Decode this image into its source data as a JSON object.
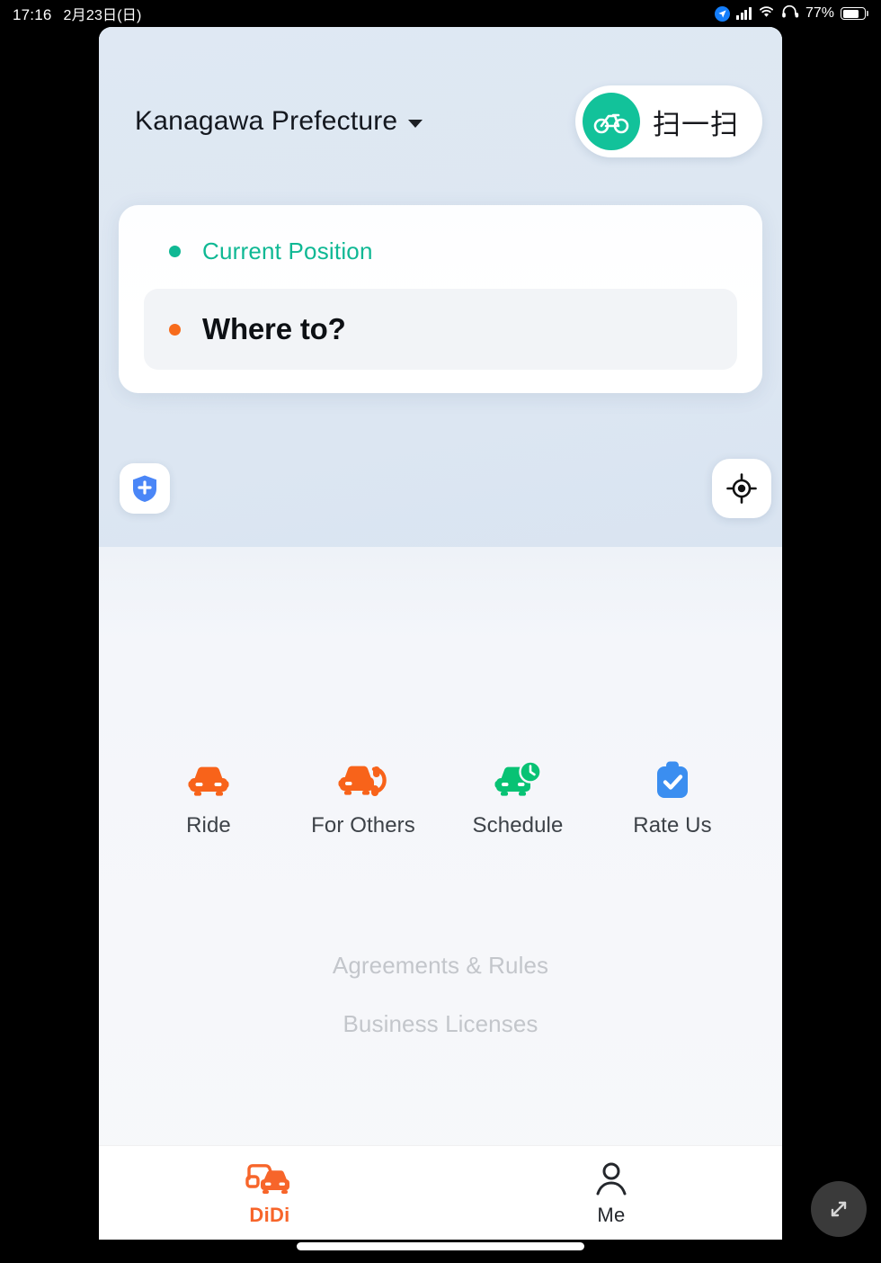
{
  "status_bar": {
    "time": "17:16",
    "date": "2月23日(日)",
    "battery_percent": "77%",
    "icons": [
      "location-arrow-icon",
      "cellular-signal-icon",
      "wifi-icon",
      "headphones-icon",
      "battery-icon"
    ]
  },
  "map": {
    "city_selector": {
      "label": "Kanagawa Prefecture",
      "icon": "chevron-down-icon"
    },
    "scan_button": {
      "label": "扫一扫",
      "icon": "bicycle-icon",
      "accent": "#12c29a"
    },
    "position_bubble": {
      "label": "Current Position",
      "chevron": "›"
    },
    "safety_button": {
      "icon": "shield-plus-icon",
      "color": "#4a86f7"
    },
    "locate_button": {
      "icon": "crosshair-locate-icon",
      "color": "#111111"
    }
  },
  "search": {
    "origin": {
      "label": "Current Position",
      "dot_color": "#10b894"
    },
    "destination": {
      "label": "Where to?",
      "dot_color": "#f76b1c"
    }
  },
  "actions": [
    {
      "label": "Ride",
      "icon": "car-icon",
      "color": "#f8631a"
    },
    {
      "label": "For Others",
      "icon": "car-phone-icon",
      "color": "#f8631a"
    },
    {
      "label": "Schedule",
      "icon": "car-clock-icon",
      "color": "#08c274"
    },
    {
      "label": "Rate Us",
      "icon": "clipboard-check-icon",
      "color": "#3b8ef0"
    }
  ],
  "legal_links": [
    {
      "label": "Agreements & Rules"
    },
    {
      "label": "Business Licenses"
    }
  ],
  "tabbar": [
    {
      "label": "DiDi",
      "icon": "two-cars-icon",
      "active": true,
      "color": "#f7652a"
    },
    {
      "label": "Me",
      "icon": "person-icon",
      "active": false,
      "color": "#24272c"
    }
  ],
  "floating_button": {
    "icon": "collapse-arrows-icon"
  }
}
